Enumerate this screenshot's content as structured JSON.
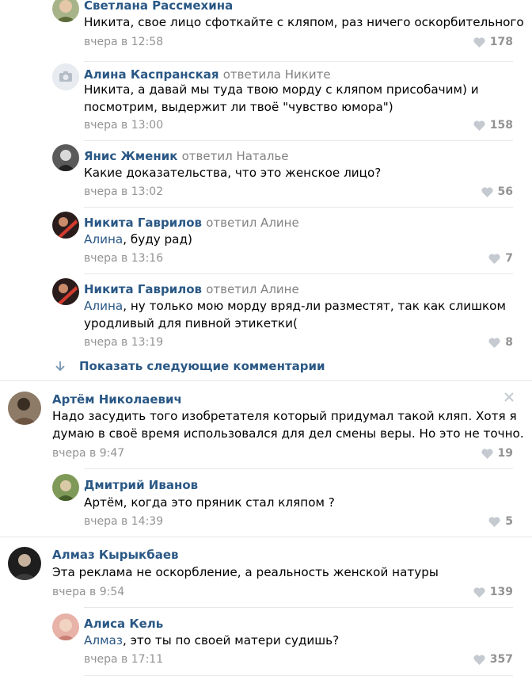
{
  "comments": [
    {
      "author": "Светлана Рассмехина",
      "reply_to": "",
      "lines": [
        "Никита, свое лицо сфоткайте с кляпом, раз ничего оскорбительного"
      ],
      "date": "вчера в 12:58",
      "likes": "178"
    },
    {
      "author": "Алина Каспранская",
      "reply_to": "ответила Никите",
      "lines": [
        "Никита, а давай мы туда твою морду с кляпом присобачим) и",
        "посмотрим, выдержит ли твоё \"чувство юмора\")"
      ],
      "date": "вчера в 13:00",
      "likes": "158"
    },
    {
      "author": "Янис Жменик",
      "reply_to": "ответил Наталье",
      "lines": [
        "Какие доказательства, что это женское лицо?"
      ],
      "date": "вчера в 13:02",
      "likes": "56"
    },
    {
      "author": "Никита Гаврилов",
      "reply_to": "ответил Алине",
      "mention": "Алина",
      "lines": [
        ", буду рад)"
      ],
      "date": "вчера в 13:16",
      "likes": "7"
    },
    {
      "author": "Никита Гаврилов",
      "reply_to": "ответил Алине",
      "mention": "Алина",
      "lines": [
        ", ну только мою морду вряд-ли разместят, так как слишком",
        "уродливый для пивной этикетки("
      ],
      "date": "вчера в 13:19",
      "likes": "8"
    },
    {
      "author": "Артём Николаевич",
      "reply_to": "",
      "lines": [
        "Надо засудить того изобретателя который придумал такой кляп. Хотя я",
        "думаю в своё время использовался для дел смены веры. Но это не точно."
      ],
      "date": "вчера в 9:47",
      "likes": "19"
    },
    {
      "author": "Дмитрий Иванов",
      "reply_to": "",
      "lines": [
        "Артём, когда это пряник стал кляпом ?"
      ],
      "date": "вчера в 14:39",
      "likes": "5"
    },
    {
      "author": "Алмаз Кырыкбаев",
      "reply_to": "",
      "lines": [
        "Эта реклама не оскорбление, а реальность женской натуры"
      ],
      "date": "вчера в 9:54",
      "likes": "139"
    },
    {
      "author": "Алиса Кель",
      "reply_to": "",
      "mention": "Алмаз",
      "lines": [
        ", это ты по своей матери судишь?"
      ],
      "date": "вчера в 17:11",
      "likes": "357"
    }
  ],
  "show_more_label": "Показать следующие комментарии",
  "colors": {
    "link": "#2a5885",
    "muted": "#939393",
    "divider": "#e7e8ec"
  }
}
